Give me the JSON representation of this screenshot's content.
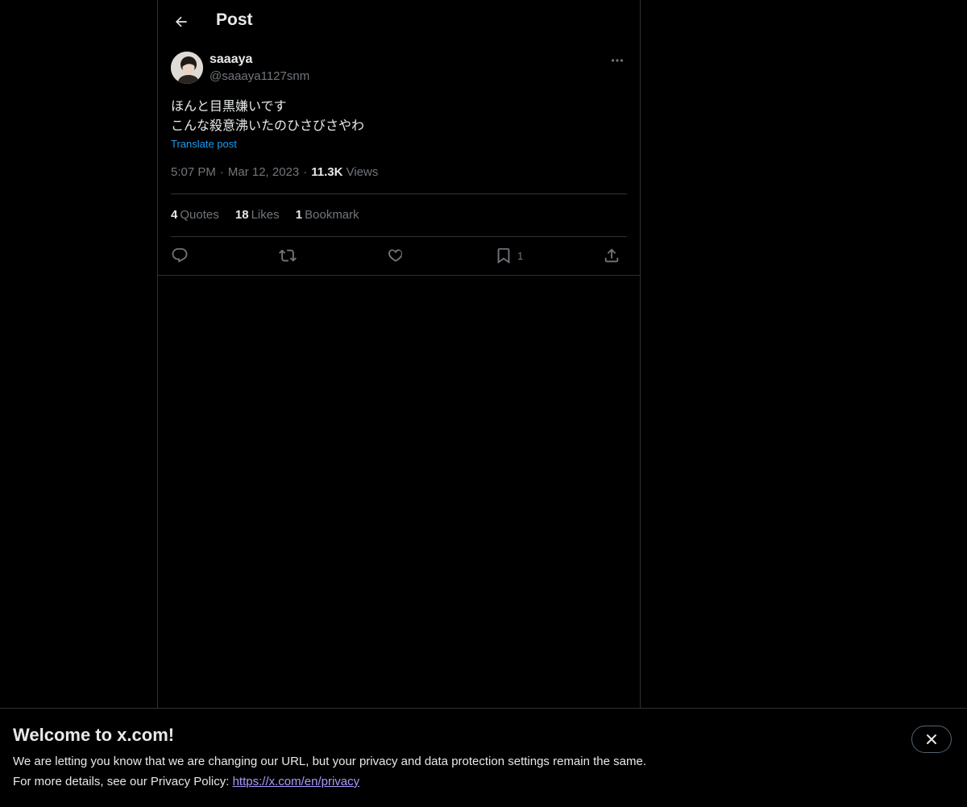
{
  "header": {
    "title": "Post"
  },
  "post": {
    "display_name": "saaaya",
    "handle": "@saaaya1127snm",
    "text": "ほんと目黒嫌いです\nこんな殺意沸いたのひさびさやわ",
    "translate_label": "Translate post",
    "time": "5:07 PM",
    "date": "Mar 12, 2023",
    "views_count": "11.3K",
    "views_label": "Views",
    "stats": {
      "quotes_count": "4",
      "quotes_label": "Quotes",
      "likes_count": "18",
      "likes_label": "Likes",
      "bookmarks_count": "1",
      "bookmarks_label": "Bookmark"
    },
    "actions": {
      "reply_icon": "reply-icon",
      "repost_icon": "repost-icon",
      "like_icon": "heart-icon",
      "bookmark_icon": "bookmark-icon",
      "bookmark_count": "1",
      "share_icon": "share-icon"
    }
  },
  "banner": {
    "title": "Welcome to x.com!",
    "line1": "We are letting you know that we are changing our URL, but your privacy and data protection settings remain the same.",
    "line2_prefix": "For more details, see our Privacy Policy: ",
    "link_text": "https://x.com/en/privacy"
  },
  "colors": {
    "background": "#000000",
    "text_primary": "#e7e9ea",
    "text_secondary": "#71767b",
    "accent_blue": "#1d9bf0",
    "link_purple": "#a99aff",
    "border": "#2f3336"
  }
}
